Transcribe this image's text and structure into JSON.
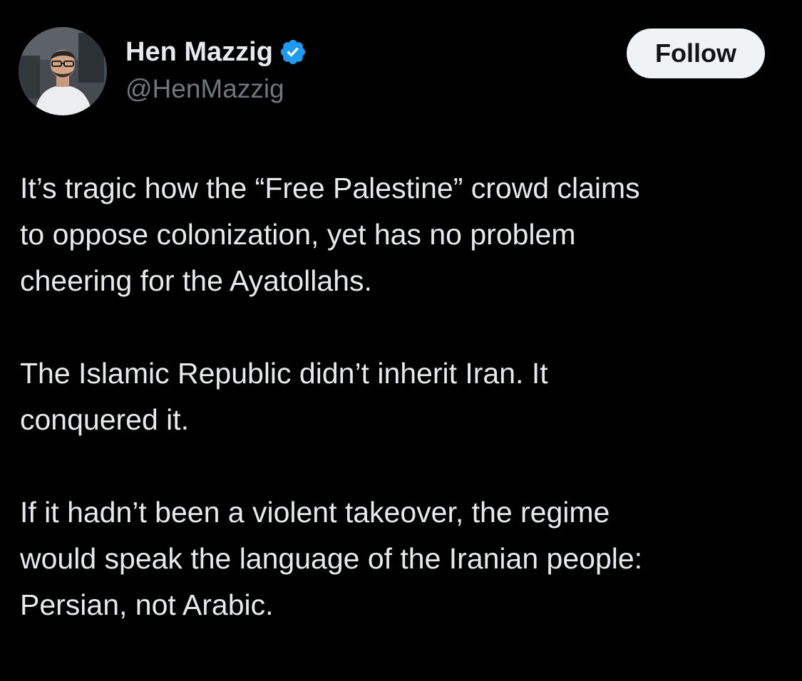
{
  "author": {
    "display_name": "Hen Mazzig",
    "handle": "@HenMazzig",
    "verified_icon": "verified-badge-icon",
    "avatar": "avatar-photo"
  },
  "follow_button": {
    "label": "Follow"
  },
  "tweet": {
    "paragraphs": [
      {
        "lines": [
          "It’s tragic how the “Free Palestine” crowd claims",
          "to oppose colonization, yet has no problem",
          "cheering for the Ayatollahs."
        ]
      },
      {
        "lines": [
          "The Islamic Republic didn’t inherit Iran. It",
          "conquered it."
        ]
      },
      {
        "lines": [
          "If it hadn’t been a violent takeover, the regime",
          "would speak the language of the Iranian people:",
          "Persian, not Arabic."
        ]
      }
    ]
  },
  "colors": {
    "background": "#000000",
    "text": "#e7e9ea",
    "secondary_text": "#71767b",
    "verified_blue": "#1d9bf0",
    "button_bg": "#eff3f4",
    "button_text": "#0f1419"
  }
}
